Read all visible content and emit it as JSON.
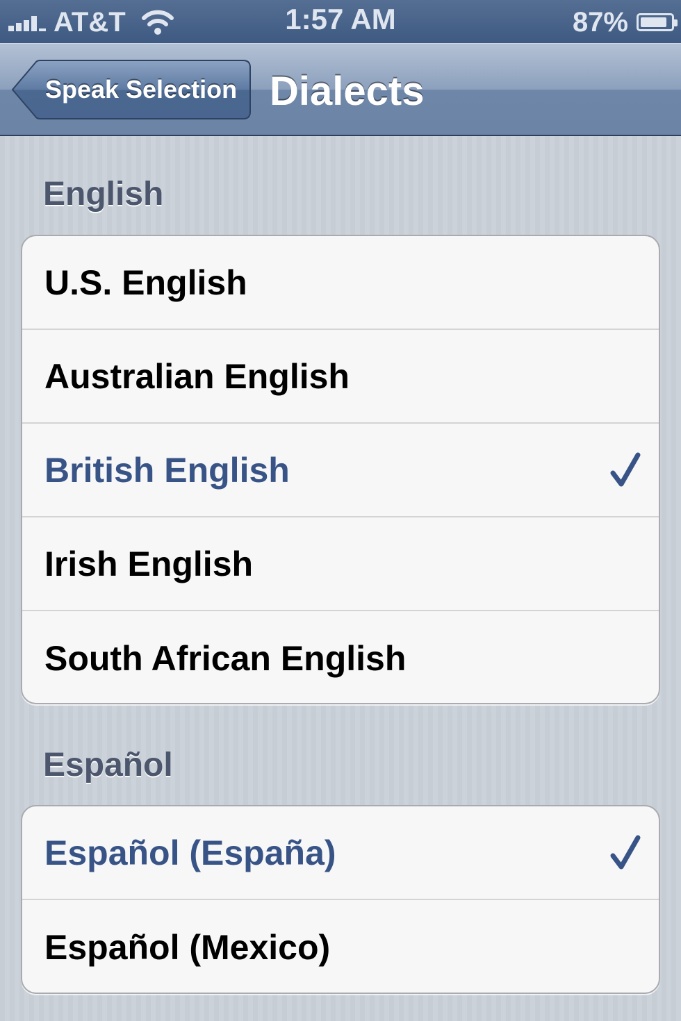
{
  "status_bar": {
    "carrier": "AT&T",
    "time": "1:57 AM",
    "battery_percent": "87%",
    "battery_level": 0.87
  },
  "nav": {
    "back_label": "Speak Selection",
    "title": "Dialects"
  },
  "sections": [
    {
      "header": "English",
      "items": [
        {
          "label": "U.S. English",
          "selected": false
        },
        {
          "label": "Australian English",
          "selected": false
        },
        {
          "label": "British English",
          "selected": true
        },
        {
          "label": "Irish English",
          "selected": false
        },
        {
          "label": "South African English",
          "selected": false
        }
      ]
    },
    {
      "header": "Español",
      "items": [
        {
          "label": "Español (España)",
          "selected": true
        },
        {
          "label": "Español (Mexico)",
          "selected": false
        }
      ]
    }
  ],
  "colors": {
    "selected_text": "#385487",
    "checkmark": "#385487",
    "nav_bar": "#6c84a6"
  },
  "icons": {
    "signal": "cellular-signal-icon",
    "wifi": "wifi-icon",
    "battery": "battery-icon",
    "checkmark": "checkmark-icon"
  }
}
